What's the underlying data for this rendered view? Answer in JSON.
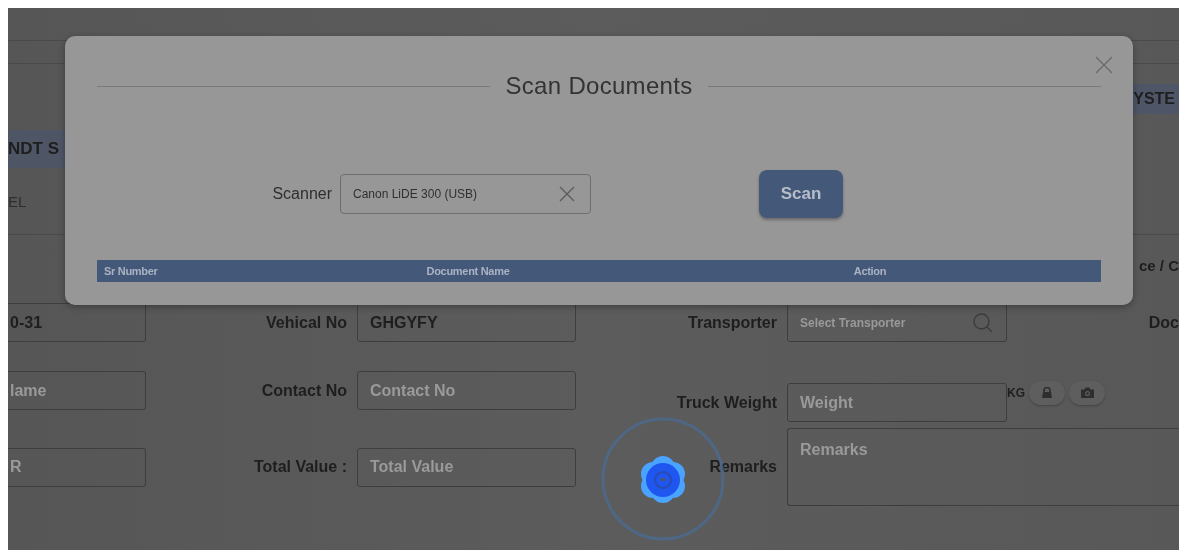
{
  "page": {
    "top_right_tab": "YSTE",
    "left_tab": "NDT S",
    "left_text": "EL",
    "right_text": "ce / C",
    "form_rows": [
      [
        {
          "kind": "input",
          "value": "0-31"
        },
        {
          "kind": "label",
          "text": "Vehical No"
        },
        {
          "kind": "input",
          "value": "GHGYFY"
        },
        {
          "kind": "label",
          "text": "Transporter"
        },
        {
          "kind": "search",
          "placeholder": "Select Transporter"
        },
        {
          "kind": "label",
          "text": "Doc"
        }
      ],
      [
        {
          "kind": "input",
          "placeholder": "lame"
        },
        {
          "kind": "label",
          "text": "Contact No"
        },
        {
          "kind": "input",
          "placeholder": "Contact No"
        },
        {
          "kind": "label",
          "text": "Truck Weight"
        },
        {
          "kind": "input",
          "placeholder": "Weight"
        },
        {
          "kind": "weight-tools",
          "text": "KG"
        }
      ],
      [
        {
          "kind": "input",
          "placeholder": "R"
        },
        {
          "kind": "label",
          "text": "Total Value :"
        },
        {
          "kind": "input",
          "placeholder": "Total Value"
        },
        {
          "kind": "label",
          "text": "Remarks"
        },
        {
          "kind": "textarea",
          "placeholder": "Remarks"
        }
      ]
    ]
  },
  "modal": {
    "title": "Scan Documents",
    "scanner_label": "Scanner",
    "scanner_value": "Canon LiDE 300 (USB)",
    "scan_button": "Scan",
    "table": {
      "columns": [
        "Sr Number",
        "Document Name",
        "Action"
      ]
    }
  },
  "loading": true
}
